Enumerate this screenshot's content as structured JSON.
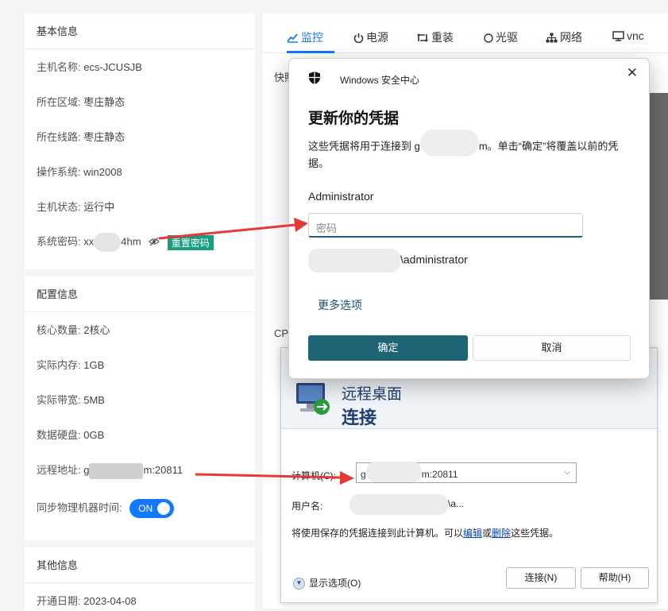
{
  "basic": {
    "title": "基本信息",
    "hostname": {
      "label": "主机名称:",
      "value": "ecs-JCUSJB"
    },
    "region": {
      "label": "所在区域:",
      "value": "枣庄静态"
    },
    "line": {
      "label": "所在线路:",
      "value": "枣庄静态"
    },
    "os": {
      "label": "操作系统:",
      "value": "win2008"
    },
    "status": {
      "label": "主机状态:",
      "value": "运行中"
    },
    "password": {
      "label": "系统密码:",
      "prefix": "xx",
      "suffix": "4hm",
      "reset": "重置密码"
    }
  },
  "config": {
    "title": "配置信息",
    "cpu": {
      "label": "核心数量:",
      "value": "2核心"
    },
    "mem": {
      "label": "实际内存:",
      "value": "1GB"
    },
    "bw": {
      "label": "实际带宽:",
      "value": "5MB"
    },
    "disk": {
      "label": "数据硬盘:",
      "value": "0GB"
    },
    "remote": {
      "label": "远程地址:",
      "prefix": "g",
      "suffix": "m:20811"
    },
    "sync": {
      "label": "同步物理机器时间:",
      "toggle": "ON"
    }
  },
  "other": {
    "title": "其他信息",
    "open_date": {
      "label": "开通日期:",
      "value": "2023-04-08"
    }
  },
  "tabs": [
    {
      "label": "监控",
      "icon": "chart-icon",
      "active": true
    },
    {
      "label": "电源",
      "icon": "power-icon"
    },
    {
      "label": "重装",
      "icon": "retweet-icon"
    },
    {
      "label": "光驱",
      "icon": "disc-icon"
    },
    {
      "label": "网络",
      "icon": "sitemap-icon"
    },
    {
      "label": "vnc",
      "icon": "monitor-icon"
    }
  ],
  "panel": {
    "cut_top": "快照",
    "cut_mid": "CP"
  },
  "security_dialog": {
    "app_name": "Windows 安全中心",
    "heading": "更新你的凭据",
    "desc_prefix": "这些凭据将用于连接到 g",
    "desc_suffix": "m。单击“确定”将覆盖以前的凭据。",
    "username": "Administrator",
    "password_placeholder": "密码",
    "domain_suffix": "\\administrator",
    "more_options": "更多选项",
    "ok": "确定",
    "cancel": "取消"
  },
  "rdc": {
    "title_line1": "远程桌面",
    "title_line2": "连接",
    "computer_label": "计算机(C):",
    "computer_prefix": "g",
    "computer_suffix": "m:20811",
    "user_label": "用户名:",
    "user_suffix": "\\a...",
    "note_prefix": "将使用保存的凭据连接到此计算机。可以",
    "note_edit": "编辑",
    "note_or": "或",
    "note_delete": "删除",
    "note_suffix": "这些凭据。",
    "show_options": "显示选项(O)",
    "connect": "连接(N)",
    "help": "帮助(H)"
  },
  "colors": {
    "accent": "#1677ff",
    "reset_btn": "#1a9d7f",
    "ok_btn": "#1e6474",
    "arrow": "#e53935"
  }
}
